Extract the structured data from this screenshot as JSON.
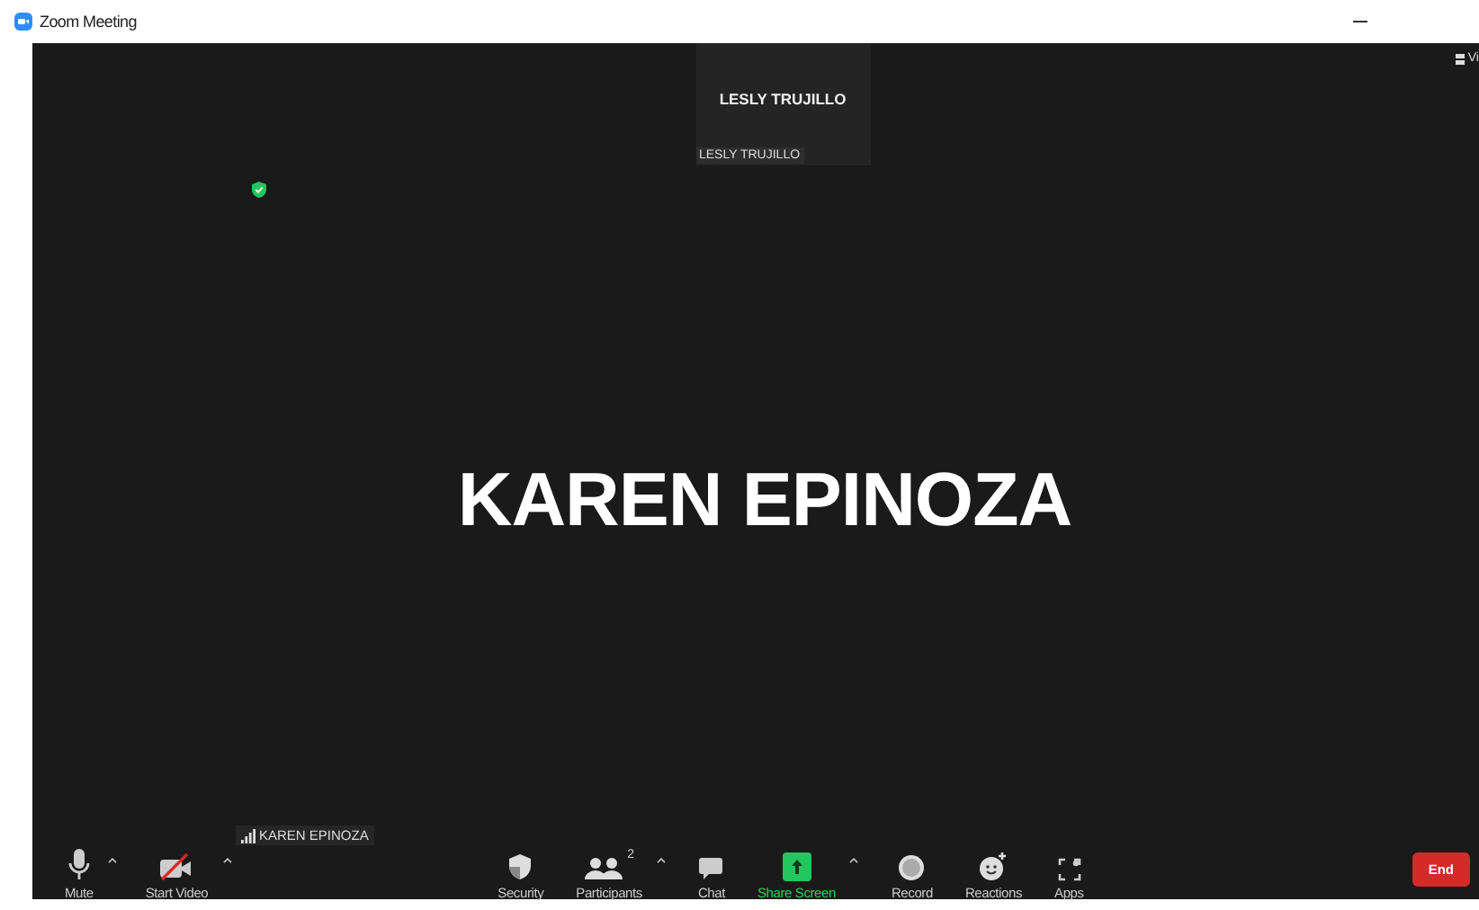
{
  "window": {
    "title": "Zoom Meeting"
  },
  "view_button": {
    "label": "Vi"
  },
  "tiles": [
    {
      "name": "LESLY TRUJILLO",
      "caption": "LESLY TRUJILLO"
    }
  ],
  "active_speaker": {
    "name": "KAREN EPINOZA"
  },
  "name_tag": {
    "name": "KAREN EPINOZA"
  },
  "toolbar": [
    {
      "kind": "mic",
      "label": "Mute",
      "caret": true
    },
    {
      "kind": "video-off",
      "label": "Start Video",
      "caret": true
    },
    {
      "kind": "security",
      "label": "Security",
      "caret": false
    },
    {
      "kind": "participants",
      "label": "Participants",
      "count": "2",
      "caret": true
    },
    {
      "kind": "chat",
      "label": "Chat",
      "caret": false
    },
    {
      "kind": "share",
      "label": "Share Screen",
      "caret": true
    },
    {
      "kind": "record",
      "label": "Record",
      "caret": false
    },
    {
      "kind": "reactions",
      "label": "Reactions",
      "caret": false
    },
    {
      "kind": "apps",
      "label": "Apps",
      "caret": false
    }
  ],
  "end_button": {
    "label": "End"
  }
}
